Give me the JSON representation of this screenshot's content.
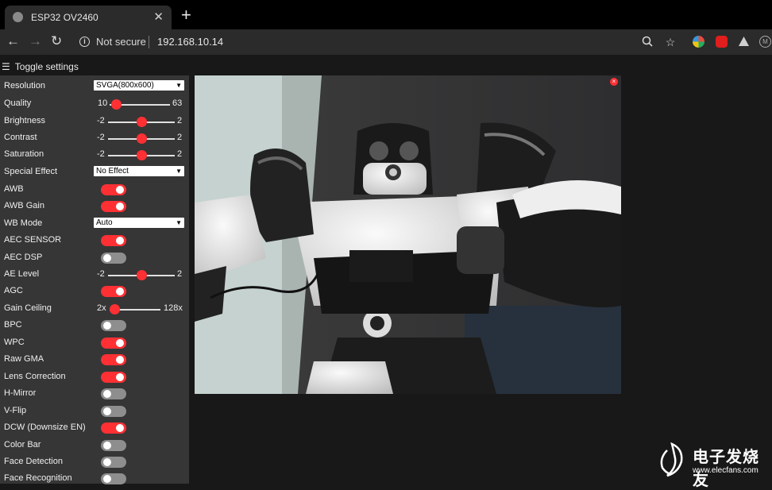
{
  "browser": {
    "tab_title": "ESP32 OV2460",
    "tab_close": "✕",
    "new_tab": "+",
    "not_secure": "Not secure",
    "url": "192.168.10.14"
  },
  "page": {
    "toggle_settings": "Toggle settings",
    "stream_close": "×"
  },
  "settings": {
    "resolution": {
      "label": "Resolution",
      "value": "SVGA(800x600)"
    },
    "quality": {
      "label": "Quality",
      "min": "10",
      "max": "63",
      "value": 10
    },
    "brightness": {
      "label": "Brightness",
      "min": "-2",
      "max": "2",
      "value": 0
    },
    "contrast": {
      "label": "Contrast",
      "min": "-2",
      "max": "2",
      "value": 0
    },
    "saturation": {
      "label": "Saturation",
      "min": "-2",
      "max": "2",
      "value": 0
    },
    "special_effect": {
      "label": "Special Effect",
      "value": "No Effect"
    },
    "awb": {
      "label": "AWB",
      "on": true
    },
    "awb_gain": {
      "label": "AWB Gain",
      "on": true
    },
    "wb_mode": {
      "label": "WB Mode",
      "value": "Auto"
    },
    "aec_sensor": {
      "label": "AEC SENSOR",
      "on": true
    },
    "aec_dsp": {
      "label": "AEC DSP",
      "on": false
    },
    "ae_level": {
      "label": "AE Level",
      "min": "-2",
      "max": "2",
      "value": 0
    },
    "agc": {
      "label": "AGC",
      "on": true
    },
    "gain_ceiling": {
      "label": "Gain Ceiling",
      "min": "2x",
      "max": "128x",
      "value": 0
    },
    "bpc": {
      "label": "BPC",
      "on": false
    },
    "wpc": {
      "label": "WPC",
      "on": true
    },
    "raw_gma": {
      "label": "Raw GMA",
      "on": true
    },
    "lens_correction": {
      "label": "Lens Correction",
      "on": true
    },
    "h_mirror": {
      "label": "H-Mirror",
      "on": false
    },
    "v_flip": {
      "label": "V-Flip",
      "on": false
    },
    "dcw": {
      "label": "DCW (Downsize EN)",
      "on": true
    },
    "color_bar": {
      "label": "Color Bar",
      "on": false
    },
    "face_detection": {
      "label": "Face Detection",
      "on": false
    },
    "face_recognition": {
      "label": "Face Recognition",
      "on": false
    }
  },
  "watermark": {
    "text": "电子发烧友",
    "url": "www.elecfans.com"
  },
  "colors": {
    "accent": "#ff3034",
    "sidebar_bg": "#363636",
    "page_bg": "#181818"
  }
}
